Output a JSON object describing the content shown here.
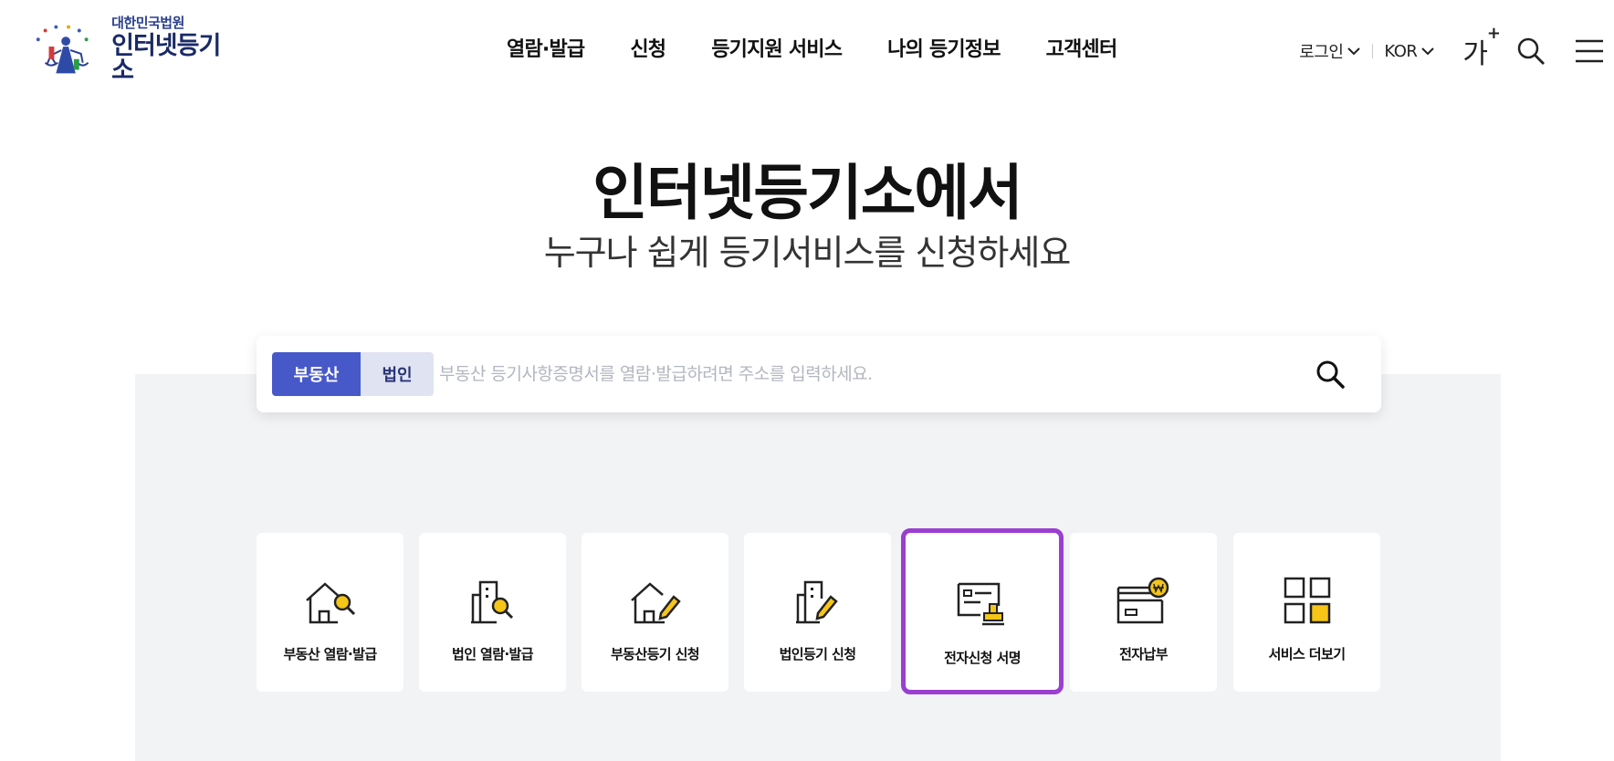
{
  "header": {
    "logo": {
      "sub": "대한민국법원",
      "main": "인터넷등기소"
    },
    "nav": [
      "열람·발급",
      "신청",
      "등기지원 서비스",
      "나의 등기정보",
      "고객센터"
    ],
    "login_label": "로그인",
    "language_label": "KOR",
    "fontsize_label": "가",
    "fontsize_plus": "+"
  },
  "hero": {
    "title": "인터넷등기소에서",
    "subtitle": "누구나 쉽게 등기서비스를 신청하세요"
  },
  "search": {
    "tab_active": "부동산",
    "tab_inactive": "법인",
    "placeholder": "부동산 등기사항증명서를 열람·발급하려면 주소를 입력하세요."
  },
  "services": [
    {
      "label": "부동산 열람·발급",
      "icon": "house-search-icon"
    },
    {
      "label": "법인 열람·발급",
      "icon": "building-search-icon"
    },
    {
      "label": "부동산등기 신청",
      "icon": "house-edit-icon"
    },
    {
      "label": "법인등기 신청",
      "icon": "building-edit-icon"
    },
    {
      "label": "전자신청 서명",
      "icon": "e-signature-icon"
    },
    {
      "label": "전자납부",
      "icon": "e-payment-icon"
    },
    {
      "label": "서비스 더보기",
      "icon": "grid-more-icon"
    }
  ],
  "colors": {
    "accent": "#4759c9",
    "highlight": "#f5c518",
    "selected_border": "#9a3fd0"
  }
}
